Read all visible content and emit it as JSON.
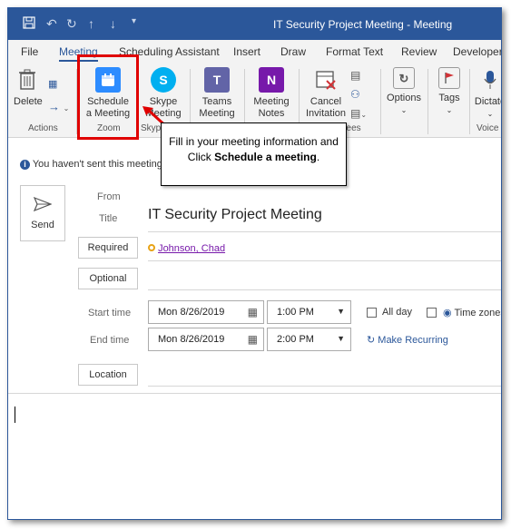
{
  "window": {
    "title": "IT Security Project Meeting  -  Meeting",
    "quick_access": [
      "save-icon",
      "undo-icon",
      "redo-icon",
      "up-icon",
      "down-icon",
      "customize-icon"
    ]
  },
  "tabs": [
    "File",
    "Meeting",
    "Scheduling Assistant",
    "Insert",
    "Draw",
    "Format Text",
    "Review",
    "Developer"
  ],
  "active_tab": "Meeting",
  "ribbon": {
    "delete_label": "Delete",
    "schedule_label_1": "Schedule",
    "schedule_label_2": "a Meeting",
    "skype_label_1": "Skype",
    "skype_label_2": "Meeting",
    "teams_label_1": "Teams",
    "teams_label_2": "Meeting",
    "notes_label_1": "Meeting",
    "notes_label_2": "Notes",
    "cancel_label_1": "Cancel",
    "cancel_label_2": "Invitation",
    "options_label": "Options",
    "tags_label": "Tags",
    "dictate_label": "Dictate",
    "groups": {
      "actions": "Actions",
      "zoom": "Zoom",
      "skype_partial": "Skyp",
      "attendees_partial": "dees",
      "voice": "Voice"
    },
    "colors": {
      "zoom": "#2d8cff",
      "skype": "#00aff0",
      "teams": "#6264a7",
      "onenote": "#7719aa"
    }
  },
  "callout": {
    "text_1": "Fill in your meeting information and",
    "text_2": "Click ",
    "text_bold": "Schedule a meeting",
    "text_end": "."
  },
  "info_bar": "You haven't sent this meeting in",
  "form": {
    "send_label": "Send",
    "from_label": "From",
    "title_label": "Title",
    "title_value": "IT Security Project Meeting",
    "required_label": "Required",
    "required_value": "Johnson, Chad",
    "optional_label": "Optional",
    "start_time_label": "Start time",
    "end_time_label": "End time",
    "start_date": "Mon 8/26/2019",
    "start_time": "1:00 PM",
    "end_date": "Mon 8/26/2019",
    "end_time": "2:00 PM",
    "all_day_label": "All day",
    "time_zones_label": "Time zones",
    "make_recurring_label": "Make Recurring",
    "location_label": "Location"
  }
}
